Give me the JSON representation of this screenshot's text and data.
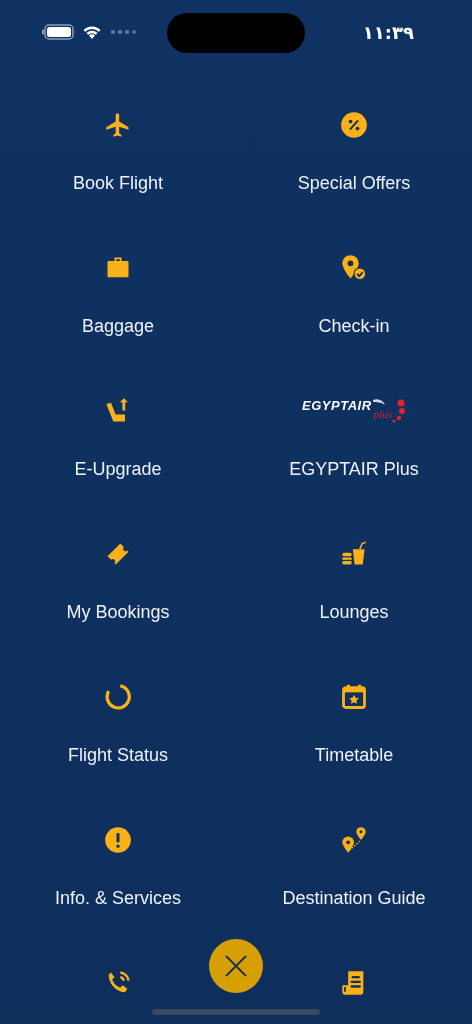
{
  "status_bar": {
    "time": "١١:٣٩"
  },
  "menu_rows": [
    {
      "items": [
        {
          "kind": "icon",
          "label": "Book Flight"
        },
        {
          "kind": "icon",
          "label": "Special Offers"
        }
      ]
    },
    {
      "items": [
        {
          "kind": "icon",
          "label": "Baggage"
        },
        {
          "kind": "icon",
          "label": "Check-in"
        }
      ]
    },
    {
      "items": [
        {
          "kind": "icon",
          "label": "E-Upgrade"
        },
        {
          "kind": "logo",
          "logo_text": "EGYPTAIR",
          "logo_subtext": "plus",
          "label": "EGYPTAIR Plus"
        }
      ]
    },
    {
      "items": [
        {
          "kind": "icon",
          "label": "My Bookings"
        },
        {
          "kind": "icon",
          "label": "Lounges"
        }
      ]
    },
    {
      "items": [
        {
          "kind": "icon",
          "label": "Flight Status"
        },
        {
          "kind": "icon",
          "label": "Timetable"
        }
      ]
    },
    {
      "items": [
        {
          "kind": "icon",
          "label": "Info. & Services"
        },
        {
          "kind": "icon",
          "label": "Destination Guide"
        }
      ]
    },
    {
      "items": [
        {
          "kind": "icon"
        },
        {
          "kind": "icon"
        }
      ]
    }
  ]
}
